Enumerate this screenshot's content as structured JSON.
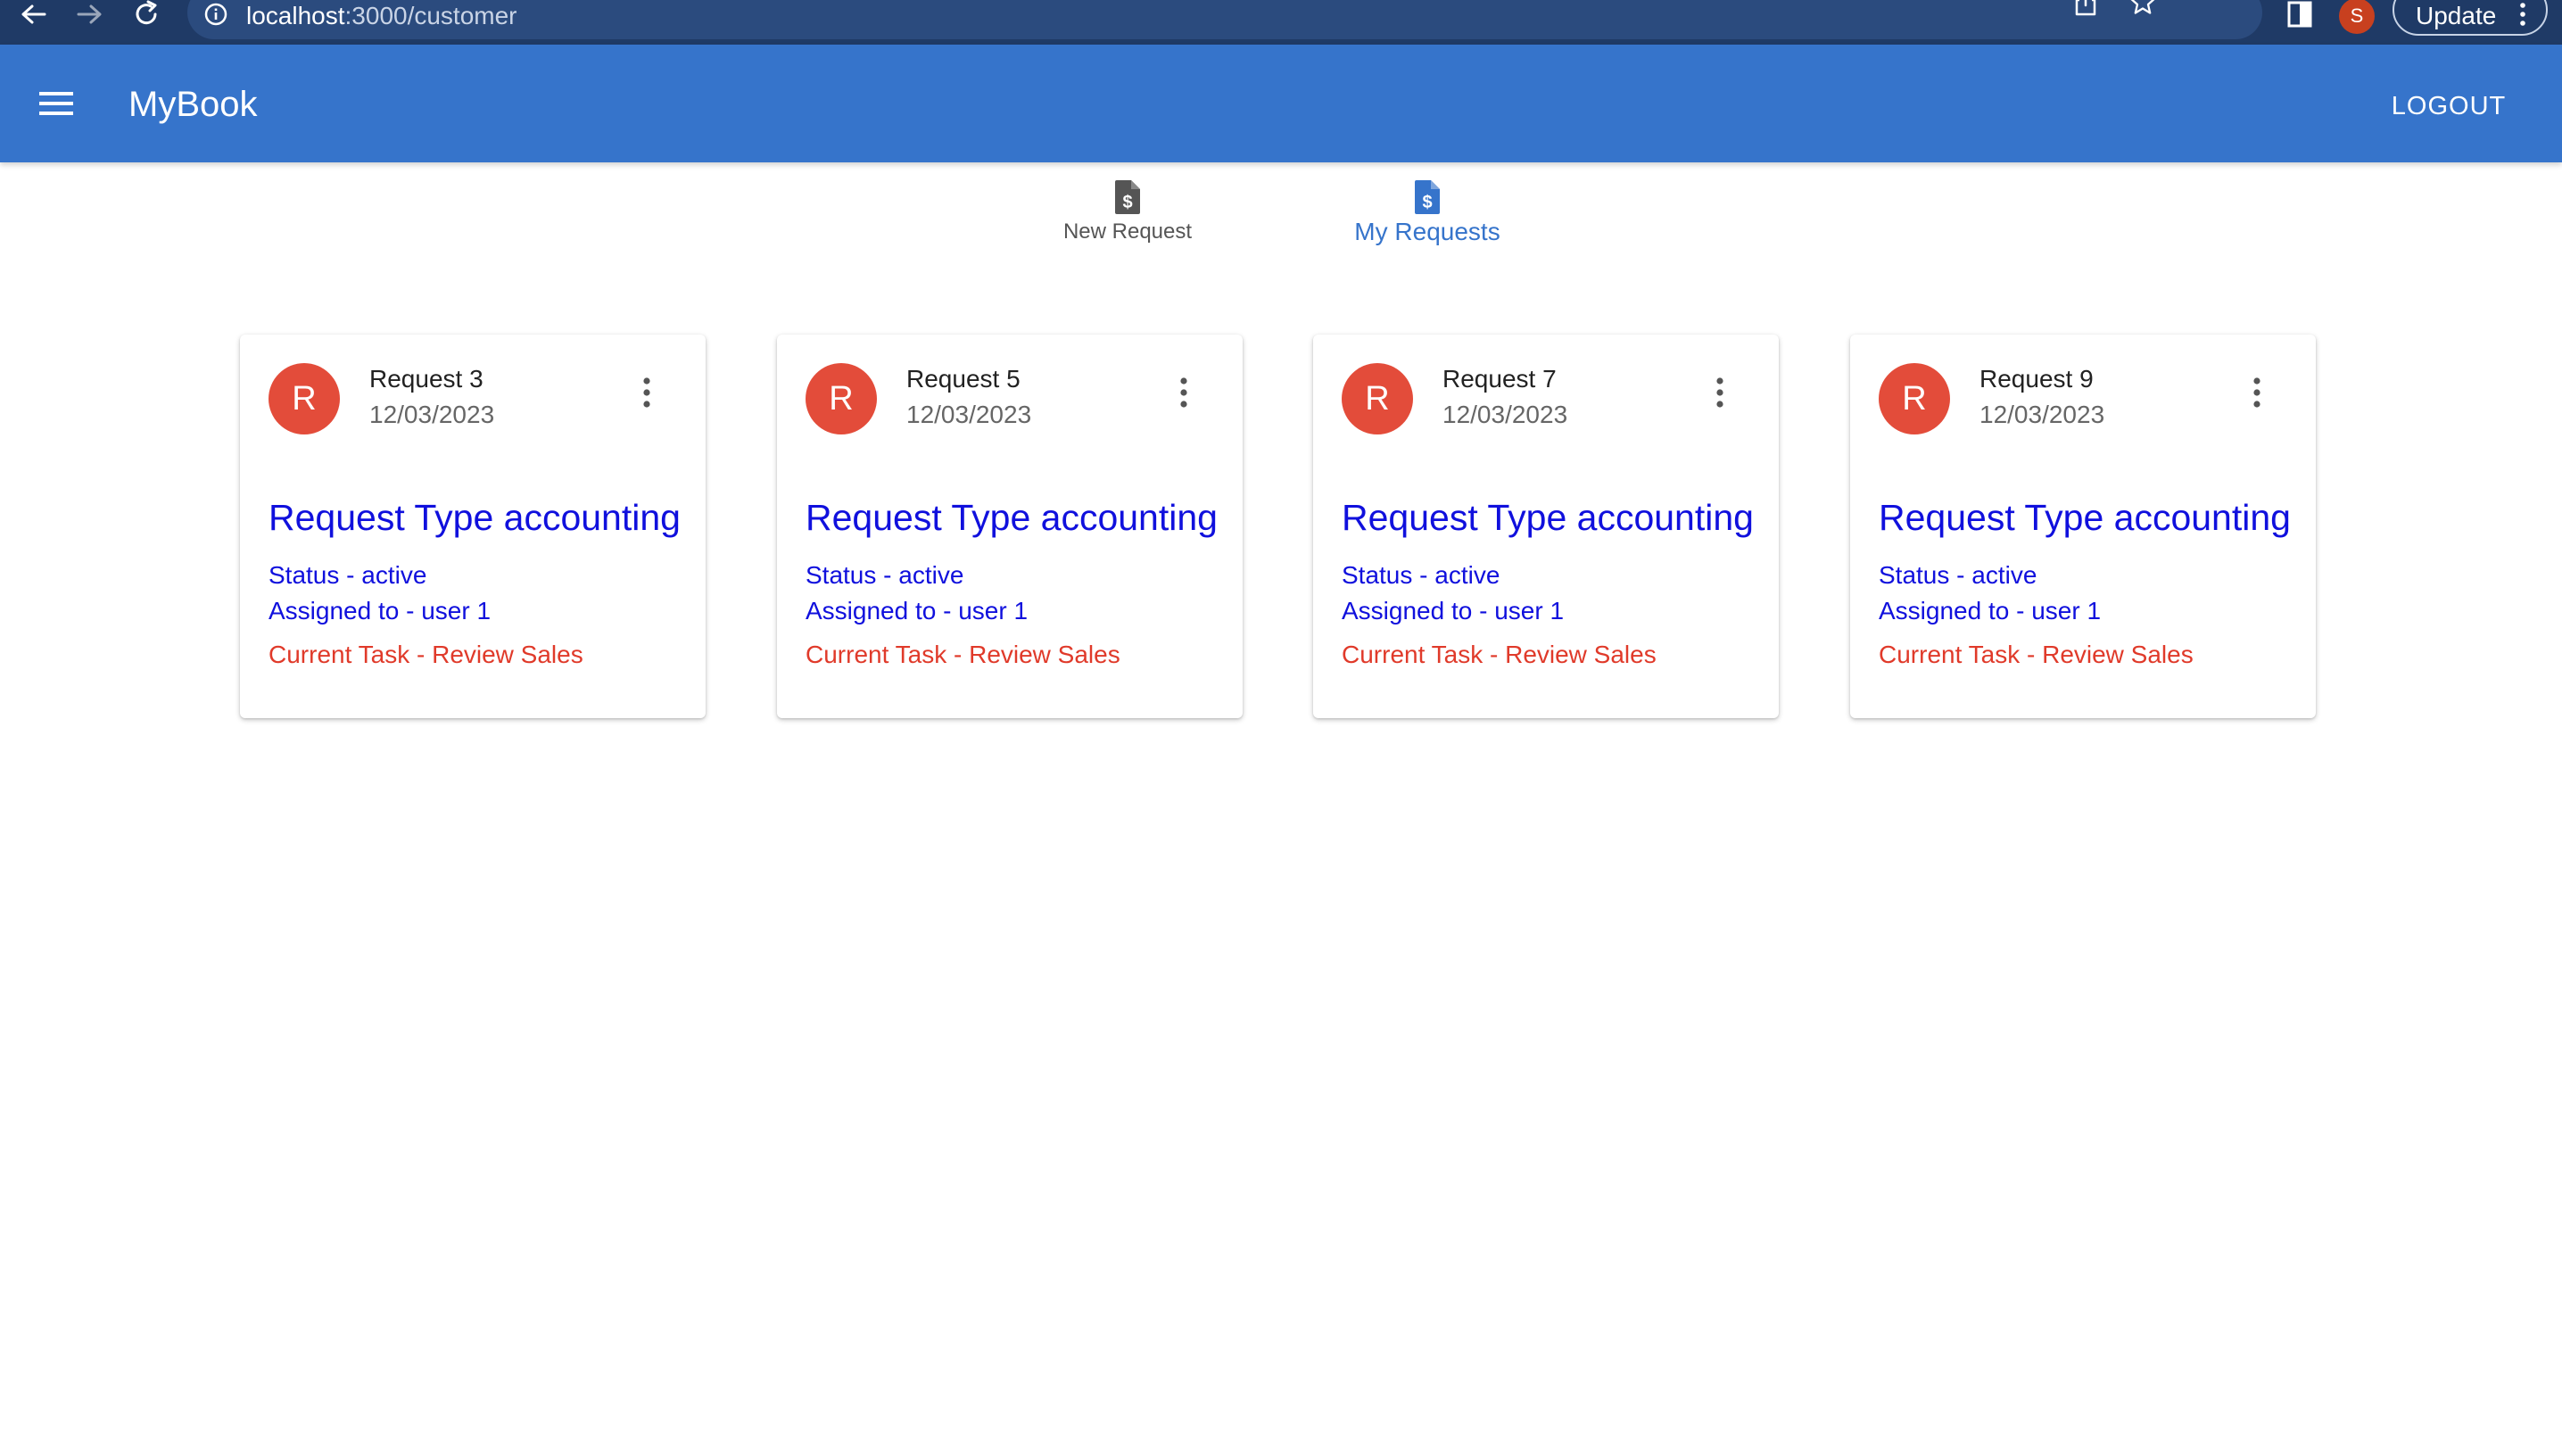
{
  "browser": {
    "url_host": "localhost",
    "url_path": ":3000/customer",
    "profile_initial": "S",
    "update_label": "Update",
    "icons": [
      "back-icon",
      "forward-icon",
      "reload-icon",
      "info-icon",
      "share-icon",
      "star-icon",
      "side-panel-icon",
      "more-vert-icon"
    ]
  },
  "app_bar": {
    "title": "MyBook",
    "logout_label": "LOGOUT",
    "background": "#3674cb"
  },
  "tabs": [
    {
      "label": "New Request",
      "icon": "request-doc-icon",
      "active": false
    },
    {
      "label": "My Requests",
      "icon": "request-doc-icon",
      "active": true
    }
  ],
  "cards": [
    {
      "avatar": "R",
      "title": "Request 3",
      "date": "12/03/2023",
      "type": "Request Type accounting",
      "status": "Status - active",
      "assigned": "Assigned to - user 1",
      "task": "Current Task - Review Sales"
    },
    {
      "avatar": "R",
      "title": "Request 5",
      "date": "12/03/2023",
      "type": "Request Type accounting",
      "status": "Status - active",
      "assigned": "Assigned to - user 1",
      "task": "Current Task - Review Sales"
    },
    {
      "avatar": "R",
      "title": "Request 7",
      "date": "12/03/2023",
      "type": "Request Type accounting",
      "status": "Status - active",
      "assigned": "Assigned to - user 1",
      "task": "Current Task - Review Sales"
    },
    {
      "avatar": "R",
      "title": "Request 9",
      "date": "12/03/2023",
      "type": "Request Type accounting",
      "status": "Status - active",
      "assigned": "Assigned to - user 1",
      "task": "Current Task - Review Sales"
    }
  ],
  "colors": {
    "accent": "#3674cb",
    "avatar": "#e34c3a",
    "link_blue": "#1010dd",
    "task_red": "#e03a2a"
  }
}
